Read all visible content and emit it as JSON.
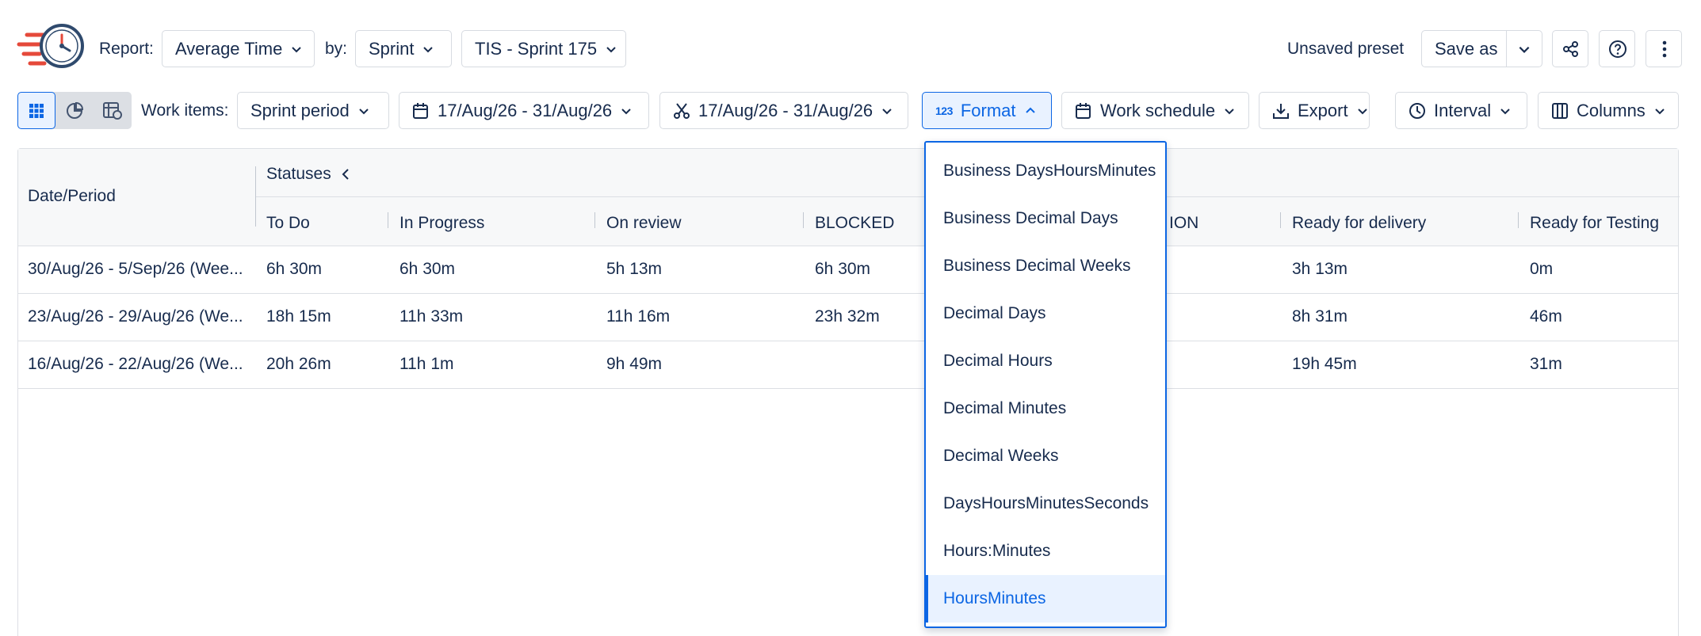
{
  "header": {
    "report_label": "Report:",
    "report_value": "Average Time",
    "by_label": "by:",
    "by_value": "Sprint",
    "sprint_value": "TIS - Sprint 175",
    "preset_status": "Unsaved preset",
    "save_as_label": "Save as"
  },
  "toolbar": {
    "work_items_label": "Work items:",
    "work_items_value": "Sprint period",
    "date_range_1": "17/Aug/26 - 31/Aug/26",
    "date_range_2": "17/Aug/26 - 31/Aug/26",
    "format_label": "Format",
    "format_icon_text": "123",
    "work_schedule_label": "Work schedule",
    "export_label": "Export",
    "interval_label": "Interval",
    "columns_label": "Columns"
  },
  "table": {
    "date_header": "Date/Period",
    "group_header": "Statuses",
    "columns": [
      "To Do",
      "In Progress",
      "On review",
      "BLOCKED",
      "ION",
      "Ready for delivery",
      "Ready for Testing"
    ],
    "rows": [
      {
        "period": "30/Aug/26 - 5/Sep/26 (Wee...",
        "values": [
          "6h 30m",
          "6h 30m",
          "5h 13m",
          "6h 30m",
          "",
          "3h 13m",
          "0m"
        ]
      },
      {
        "period": "23/Aug/26 - 29/Aug/26 (We...",
        "values": [
          "18h 15m",
          "11h 33m",
          "11h 16m",
          "23h 32m",
          "",
          "8h 31m",
          "46m"
        ]
      },
      {
        "period": "16/Aug/26 - 22/Aug/26 (We...",
        "values": [
          "20h 26m",
          "11h 1m",
          "9h 49m",
          "",
          "",
          "19h 45m",
          "31m"
        ]
      }
    ]
  },
  "format_dropdown": {
    "options": [
      "Business DaysHoursMinutes",
      "Business Decimal Days",
      "Business Decimal Weeks",
      "Decimal Days",
      "Decimal Hours",
      "Decimal Minutes",
      "Decimal Weeks",
      "DaysHoursMinutesSeconds",
      "Hours:Minutes",
      "HoursMinutes"
    ],
    "selected": "HoursMinutes"
  },
  "colors": {
    "accent": "#0c66e4",
    "accent_bg": "#e9f2ff",
    "text": "#172b4d",
    "border": "#dcdfe4",
    "logo_red": "#e5493a",
    "logo_navy": "#2f4a6d"
  }
}
